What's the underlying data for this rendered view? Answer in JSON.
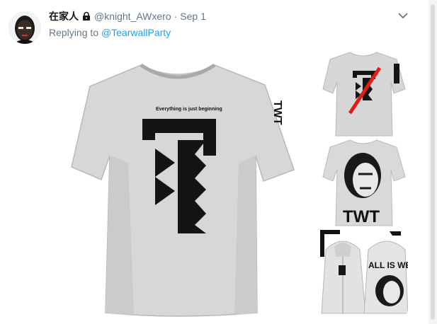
{
  "tweet": {
    "display_name": "在家人",
    "handle": "@knight_AWxero",
    "separator": "·",
    "timestamp": "Sep 1",
    "reply_prefix": "Replying to",
    "reply_mention": "@TearwallParty",
    "icons": {
      "avatar": "avatar-portrait",
      "protected": "lock-icon",
      "menu": "chevron-down-icon"
    }
  },
  "media": {
    "main_shirt_text": "Everything is just beginning",
    "sleeve_text": "TWT",
    "thumb2_text": "TWT",
    "thumb3_text": "ALL IS WEL"
  },
  "colors": {
    "link": "#1da1f2",
    "meta": "#657786",
    "name": "#14171a",
    "slash_red": "#e41b1b"
  }
}
